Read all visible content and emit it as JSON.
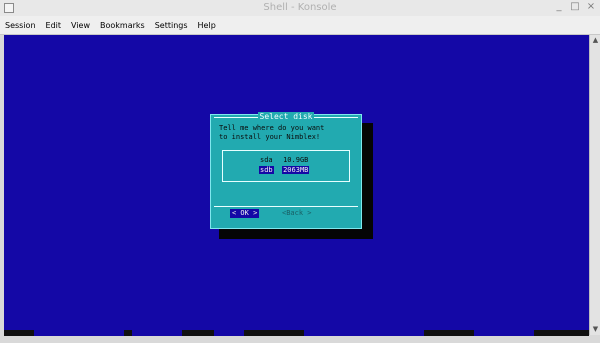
{
  "window": {
    "title": "Shell - Konsole"
  },
  "menubar": {
    "items": [
      "Session",
      "Edit",
      "View",
      "Bookmarks",
      "Settings",
      "Help"
    ]
  },
  "dialog": {
    "title": "Select disk",
    "message_line1": "Tell me where do you want",
    "message_line2": "to install your Nimblex!",
    "disks": [
      {
        "device": "sda",
        "size": "10.9GB",
        "selected": false
      },
      {
        "device": "sdb",
        "size": "2063MB",
        "selected": true
      }
    ],
    "ok_label": "< OK >",
    "back_label": "<Back >"
  }
}
